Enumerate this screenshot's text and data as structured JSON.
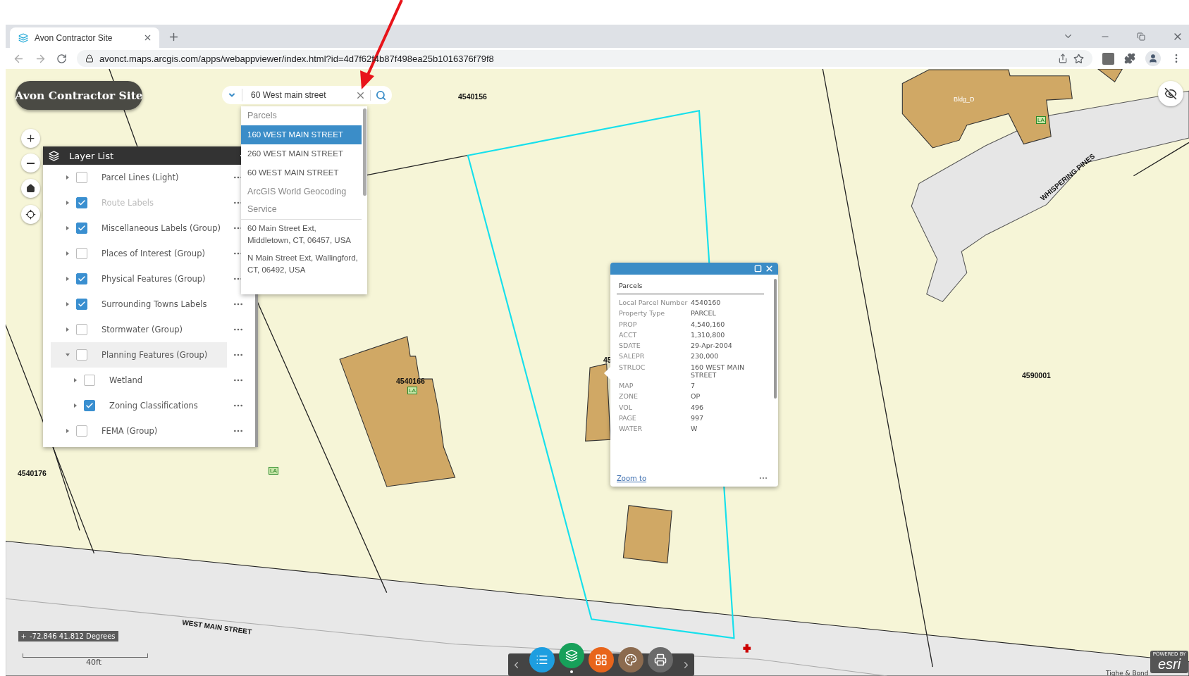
{
  "browser": {
    "tab": {
      "title": "Avon Contractor Site"
    },
    "url": "avonct.maps.arcgis.com/apps/webappviewer/index.html?id=4d7f62f4b87f498ea25b1016376f79f8"
  },
  "app": {
    "title": "Avon Contractor Site"
  },
  "search": {
    "value": "60 West main street"
  },
  "suggestions": [
    {
      "kind": "header",
      "text": "Parcels"
    },
    {
      "kind": "item",
      "text": "160 WEST MAIN STREET",
      "selected": true
    },
    {
      "kind": "item",
      "text": "260 WEST MAIN STREET",
      "selected": false
    },
    {
      "kind": "item",
      "text": "60 WEST MAIN STREET",
      "selected": false
    },
    {
      "kind": "header",
      "text": "ArcGIS World Geocoding Service"
    },
    {
      "kind": "item",
      "text": "60 Main Street Ext, Middletown, CT, 06457, USA",
      "selected": false
    },
    {
      "kind": "item",
      "text": "N Main Street Ext, Wallingford, CT, 06492, USA",
      "selected": false
    }
  ],
  "layer_list": {
    "title": "Layer List",
    "layers": [
      {
        "name": "Parcel Lines (Light)",
        "checked": false,
        "disabled": false,
        "expanded": false
      },
      {
        "name": "Route Labels",
        "checked": true,
        "disabled": true,
        "expanded": false
      },
      {
        "name": "Miscellaneous Labels (Group)",
        "checked": true,
        "disabled": false,
        "expanded": false
      },
      {
        "name": "Places of Interest (Group)",
        "checked": false,
        "disabled": false,
        "expanded": false
      },
      {
        "name": "Physical Features (Group)",
        "checked": true,
        "disabled": false,
        "expanded": false
      },
      {
        "name": "Surrounding Towns Labels",
        "checked": true,
        "disabled": false,
        "expanded": false
      },
      {
        "name": "Stormwater (Group)",
        "checked": false,
        "disabled": false,
        "expanded": false
      },
      {
        "name": "Planning Features (Group)",
        "checked": false,
        "disabled": false,
        "expanded": true,
        "children": [
          {
            "name": "Wetland",
            "checked": false,
            "disabled": false,
            "expanded": false
          },
          {
            "name": "Zoning Classifications",
            "checked": true,
            "disabled": false,
            "expanded": false
          }
        ]
      },
      {
        "name": "FEMA (Group)",
        "checked": false,
        "disabled": false,
        "expanded": false
      }
    ]
  },
  "popup": {
    "title": "Parcels",
    "fields": [
      {
        "label": "Local Parcel Number",
        "value": "4540160"
      },
      {
        "label": "Property Type",
        "value": "PARCEL"
      },
      {
        "label": "PROP",
        "value": "4,540,160"
      },
      {
        "label": "ACCT",
        "value": "1,310,800"
      },
      {
        "label": "SDATE",
        "value": "29-Apr-2004"
      },
      {
        "label": "SALEPR",
        "value": "230,000"
      },
      {
        "label": "STRLOC",
        "value": "160 WEST MAIN STREET"
      },
      {
        "label": "MAP",
        "value": "7"
      },
      {
        "label": "ZONE",
        "value": "OP"
      },
      {
        "label": "VOL",
        "value": "496"
      },
      {
        "label": "PAGE",
        "value": "997"
      },
      {
        "label": "WATER",
        "value": "W"
      }
    ],
    "link": "Zoom to"
  },
  "map_labels": [
    {
      "kind": "parcel",
      "text": "4540156"
    },
    {
      "kind": "building",
      "text": "Bldg_D"
    },
    {
      "kind": "la",
      "text": "LA"
    },
    {
      "kind": "street",
      "text": "WHISPERING PINES"
    },
    {
      "kind": "parcel",
      "text": "4540166"
    },
    {
      "kind": "la",
      "text": "LA"
    },
    {
      "kind": "parcel",
      "text": "45"
    },
    {
      "kind": "parcel",
      "text": "4590001"
    },
    {
      "kind": "parcel",
      "text": "4540176"
    },
    {
      "kind": "la",
      "text": "LA"
    },
    {
      "kind": "street",
      "text": "WEST MAIN STREET"
    }
  ],
  "coordinates": "-72.846 41.812 Degrees",
  "scale": "40ft",
  "attribution": "Tighe & Bond",
  "logo": {
    "caption": "POWERED BY",
    "text": "esri"
  },
  "toolbar": [
    {
      "kind": "list",
      "color": "#1e9ee0",
      "selected": false
    },
    {
      "kind": "layers",
      "color": "#17a05a",
      "selected": true
    },
    {
      "kind": "grid",
      "color": "#e8651c",
      "selected": false
    },
    {
      "kind": "palette",
      "color": "#8c6b4f",
      "selected": false
    },
    {
      "kind": "print",
      "color": "#6a6a6a",
      "selected": false
    }
  ]
}
